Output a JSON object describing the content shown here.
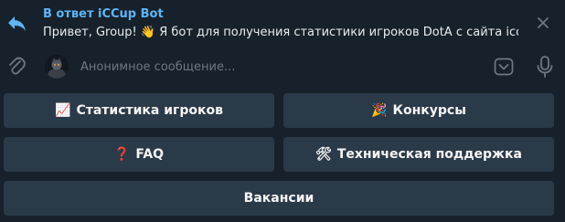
{
  "reply": {
    "title": "В ответ iCCup Bot",
    "message": "Привет, Group! 👋  Я бот для получения статистики игроков DotA с сайта iccup.c..."
  },
  "composer": {
    "placeholder": "Анонимное сообщение..."
  },
  "keyboard": {
    "buttons": [
      {
        "emoji": "📈",
        "label": "Статистика игроков"
      },
      {
        "emoji": "🎉",
        "label": "Конкурсы"
      },
      {
        "emoji": "❓",
        "label": "FAQ"
      },
      {
        "emoji": "🛠",
        "label": "Техническая поддержка"
      },
      {
        "emoji": "",
        "label": "Вакансии"
      }
    ]
  },
  "icons": [
    "reply-arrow-icon",
    "close-icon",
    "paperclip-icon",
    "keyboard-toggle-icon",
    "microphone-icon"
  ],
  "colors": {
    "background": "#17212b",
    "accent": "#5eb5f7",
    "button": "#2b3a49",
    "muted": "#6c7883"
  }
}
